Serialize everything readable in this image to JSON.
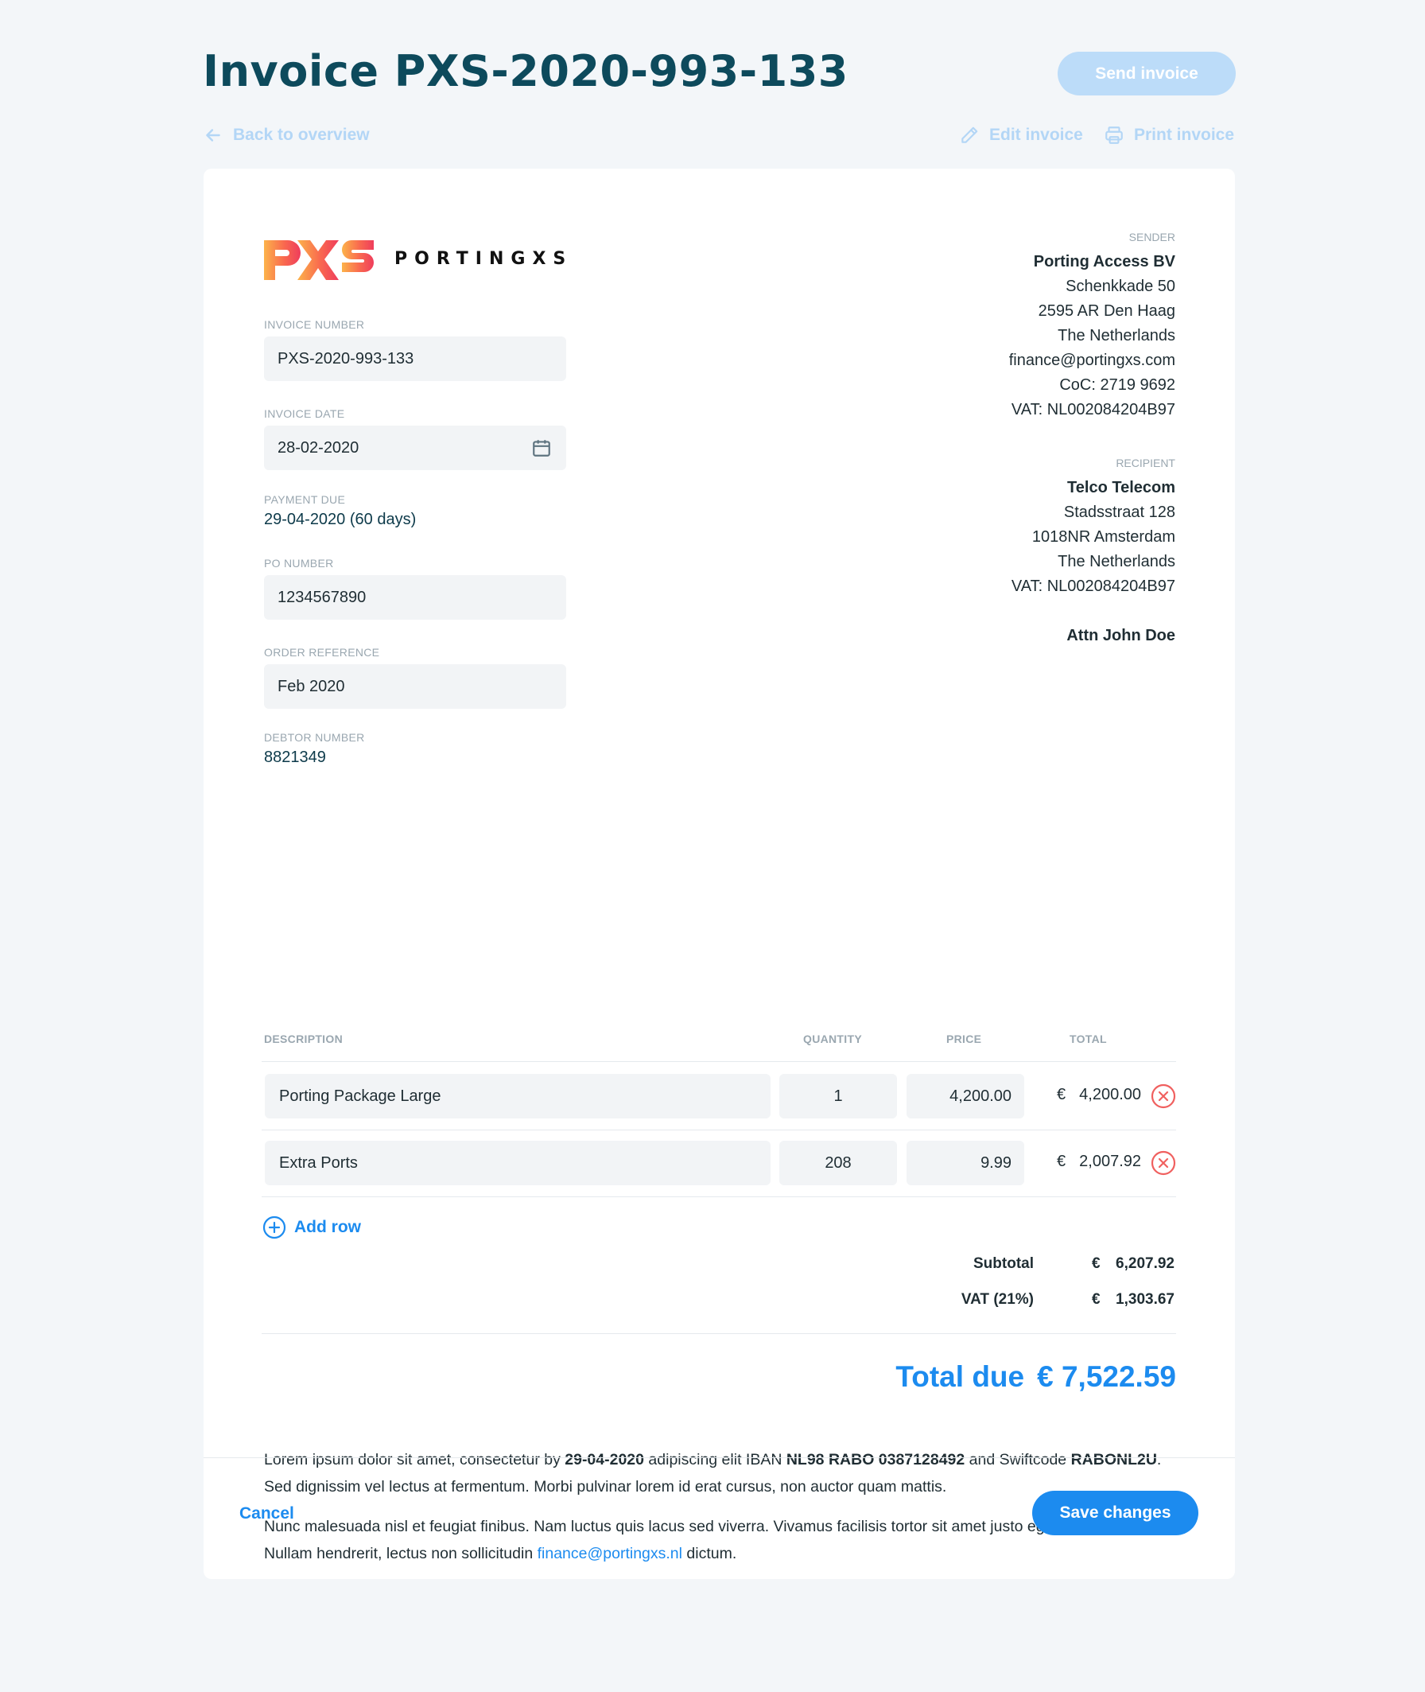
{
  "header": {
    "title": "Invoice PXS-2020-993-133",
    "send_label": "Send invoice",
    "back_label": "Back to overview",
    "edit_label": "Edit invoice",
    "print_label": "Print invoice"
  },
  "brand": {
    "name": "PORTINGXS",
    "logo_text": "PXS"
  },
  "fields": {
    "invoice_number": {
      "label": "INVOICE NUMBER",
      "value": "PXS-2020-993-133"
    },
    "invoice_date": {
      "label": "INVOICE DATE",
      "value": "28-02-2020"
    },
    "payment_due": {
      "label": "PAYMENT DUE",
      "value": "29-04-2020 (60 days)"
    },
    "po_number": {
      "label": "PO NUMBER",
      "value": "1234567890"
    },
    "order_reference": {
      "label": "ORDER REFERENCE",
      "value": "Feb 2020"
    },
    "debtor_number": {
      "label": "DEBTOR NUMBER",
      "value": "8821349"
    }
  },
  "sender": {
    "label": "SENDER",
    "name": "Porting Access BV",
    "street": "Schenkkade 50",
    "city": "2595 AR Den Haag",
    "country": "The Netherlands",
    "email": "finance@portingxs.com",
    "coc": "CoC: 2719 9692",
    "vat": "VAT: NL002084204B97"
  },
  "recipient": {
    "label": "RECIPIENT",
    "name": "Telco Telecom",
    "street": "Stadsstraat 128",
    "city": "1018NR Amsterdam",
    "country": "The Netherlands",
    "vat": "VAT: NL002084204B97",
    "attn": "Attn John Doe"
  },
  "table": {
    "headers": {
      "description": "DESCRIPTION",
      "quantity": "QUANTITY",
      "price": "PRICE",
      "total": "TOTAL"
    },
    "rows": [
      {
        "description": "Porting Package Large",
        "quantity": "1",
        "price": "4,200.00",
        "currency": "€",
        "total": "4,200.00"
      },
      {
        "description": "Extra Ports",
        "quantity": "208",
        "price": "9.99",
        "currency": "€",
        "total": "2,007.92"
      }
    ],
    "add_row_label": "Add row"
  },
  "summary": {
    "currency": "€",
    "subtotal_label": "Subtotal",
    "subtotal": "6,207.92",
    "vat_label": "VAT (21%)",
    "vat": "1,303.67",
    "total_due_label": "Total due",
    "total_due": "€ 7,522.59"
  },
  "notes": {
    "p1_a": "Lorem ipsum dolor sit amet, consectetur by ",
    "p1_date": "29-04-2020",
    "p1_b": " adipiscing elit IBAN ",
    "p1_iban": "NL98 RABO 0387128492",
    "p1_c": " and Swiftcode ",
    "p1_swift": "RABONL2U",
    "p1_d": ". Sed dignissim vel lectus at fermentum. Morbi pulvinar lorem id erat cursus, non auctor quam mattis.",
    "p2_a": "Nunc malesuada nisl et feugiat finibus. Nam luctus quis lacus sed viverra. Vivamus facilisis tortor sit amet justo egestas facilisis. Nullam hendrerit, lectus non sollicitudin ",
    "p2_email": "finance@portingxs.nl",
    "p2_b": " dictum."
  },
  "footer": {
    "cancel_label": "Cancel",
    "save_label": "Save changes"
  },
  "colors": {
    "accent": "#1c8bef",
    "title": "#0d4a5c",
    "background": "#f3f6f9",
    "danger": "#f0605f"
  }
}
